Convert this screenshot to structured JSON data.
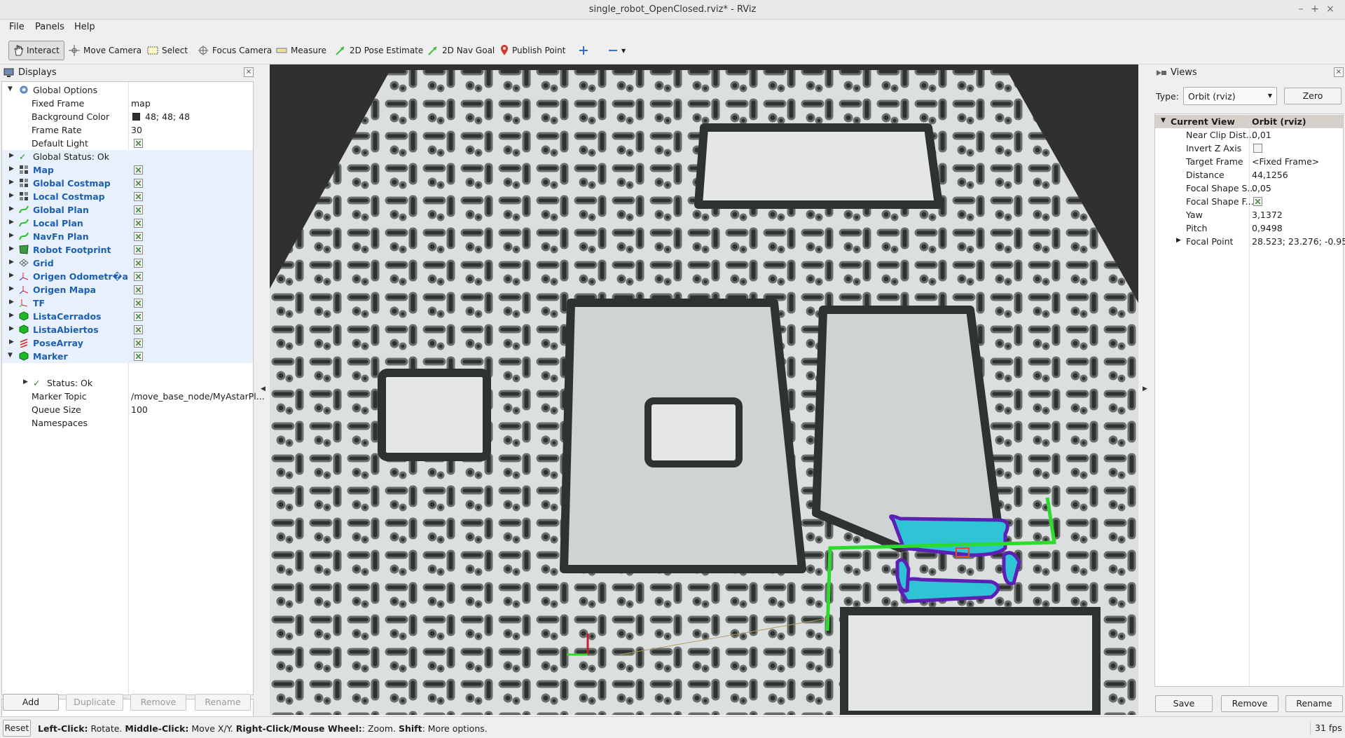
{
  "window": {
    "title": "single_robot_OpenClosed.rviz* - RViz"
  },
  "menu": [
    "File",
    "Panels",
    "Help"
  ],
  "toolbar": {
    "tools": [
      {
        "label": "Interact",
        "icon": "hand-icon"
      },
      {
        "label": "Move Camera",
        "icon": "move-camera-icon"
      },
      {
        "label": "Select",
        "icon": "select-icon"
      },
      {
        "label": "Focus Camera",
        "icon": "focus-camera-icon"
      },
      {
        "label": "Measure",
        "icon": "measure-icon"
      },
      {
        "label": "2D Pose Estimate",
        "icon": "pose-estimate-icon"
      },
      {
        "label": "2D Nav Goal",
        "icon": "nav-goal-icon"
      },
      {
        "label": "Publish Point",
        "icon": "publish-point-icon"
      }
    ]
  },
  "displays": {
    "title": "Displays",
    "global_options": "Global Options",
    "fixed_frame": {
      "label": "Fixed Frame",
      "value": "map"
    },
    "background_color": {
      "label": "Background Color",
      "value": "48; 48; 48",
      "swatch": "#303030"
    },
    "frame_rate": {
      "label": "Frame Rate",
      "value": "30"
    },
    "default_light": {
      "label": "Default Light"
    },
    "global_status": "Global Status: Ok",
    "items": [
      {
        "label": "Map",
        "icon": "map-icon"
      },
      {
        "label": "Global Costmap",
        "icon": "map-icon"
      },
      {
        "label": "Local Costmap",
        "icon": "map-icon"
      },
      {
        "label": "Global Plan",
        "icon": "path-icon"
      },
      {
        "label": "Local Plan",
        "icon": "path-icon"
      },
      {
        "label": "NavFn Plan",
        "icon": "path-icon"
      },
      {
        "label": "Robot Footprint",
        "icon": "polygon-icon"
      },
      {
        "label": "Grid",
        "icon": "grid-icon"
      },
      {
        "label": "Origen Odometr�a",
        "icon": "axes-icon"
      },
      {
        "label": "Origen Mapa",
        "icon": "axes-icon"
      },
      {
        "label": "TF",
        "icon": "tf-icon"
      },
      {
        "label": "ListaCerrados",
        "icon": "marker-icon"
      },
      {
        "label": "ListaAbiertos",
        "icon": "marker-icon"
      },
      {
        "label": "PoseArray",
        "icon": "pose-array-icon"
      },
      {
        "label": "Marker",
        "icon": "marker-icon"
      }
    ],
    "marker": {
      "status": "Status: Ok",
      "topic_label": "Marker Topic",
      "topic_value": "/move_base_node/MyAstarPl...",
      "queue_label": "Queue Size",
      "queue_value": "100",
      "namespaces_label": "Namespaces"
    },
    "buttons": {
      "add": "Add",
      "duplicate": "Duplicate",
      "remove": "Remove",
      "rename": "Rename"
    }
  },
  "views": {
    "title": "Views",
    "type_label": "Type:",
    "type_value": "Orbit (rviz)",
    "zero": "Zero",
    "current_view": "Current View",
    "current_view_type": "Orbit (rviz)",
    "props": [
      {
        "label": "Near Clip Dist...",
        "value": "0,01"
      },
      {
        "label": "Invert Z Axis",
        "value": ""
      },
      {
        "label": "Target Frame",
        "value": "<Fixed Frame>"
      },
      {
        "label": "Distance",
        "value": "44,1256"
      },
      {
        "label": "Focal Shape S...",
        "value": "0,05"
      },
      {
        "label": "Focal Shape F...",
        "value": ""
      },
      {
        "label": "Yaw",
        "value": "3,1372"
      },
      {
        "label": "Pitch",
        "value": "0,9498"
      },
      {
        "label": "Focal Point",
        "value": "28.523; 23.276; -0.95..."
      }
    ],
    "buttons": {
      "save": "Save",
      "remove": "Remove",
      "rename": "Rename"
    }
  },
  "statusbar": {
    "reset": "Reset",
    "b1": "Left-Click:",
    "t1": " Rotate. ",
    "b2": "Middle-Click:",
    "t2": " Move X/Y. ",
    "b3": "Right-Click/Mouse Wheel:",
    "t3": ": Zoom. ",
    "b4": "Shift",
    "t4": ": More options.",
    "fps": "31 fps"
  }
}
